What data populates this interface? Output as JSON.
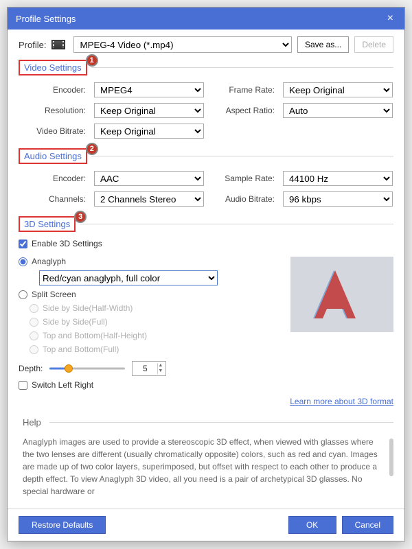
{
  "title": "Profile Settings",
  "profile": {
    "label": "Profile:",
    "value": "MPEG-4 Video (*.mp4)",
    "save_as": "Save as...",
    "delete": "Delete"
  },
  "sections": {
    "video": {
      "title": "Video Settings",
      "badge": "1"
    },
    "audio": {
      "title": "Audio Settings",
      "badge": "2"
    },
    "threeD": {
      "title": "3D Settings",
      "badge": "3"
    },
    "help": {
      "title": "Help"
    }
  },
  "video": {
    "encoder_label": "Encoder:",
    "encoder": "MPEG4",
    "resolution_label": "Resolution:",
    "resolution": "Keep Original",
    "bitrate_label": "Video Bitrate:",
    "bitrate": "Keep Original",
    "framerate_label": "Frame Rate:",
    "framerate": "Keep Original",
    "aspect_label": "Aspect Ratio:",
    "aspect": "Auto"
  },
  "audio": {
    "encoder_label": "Encoder:",
    "encoder": "AAC",
    "channels_label": "Channels:",
    "channels": "2 Channels Stereo",
    "samplerate_label": "Sample Rate:",
    "samplerate": "44100 Hz",
    "bitrate_label": "Audio Bitrate:",
    "bitrate": "96 kbps"
  },
  "threeD": {
    "enable": "Enable 3D Settings",
    "anaglyph": "Anaglyph",
    "anaglyph_mode": "Red/cyan anaglyph, full color",
    "split": "Split Screen",
    "split_modes": {
      "sbs_half": "Side by Side(Half-Width)",
      "sbs_full": "Side by Side(Full)",
      "tb_half": "Top and Bottom(Half-Height)",
      "tb_full": "Top and Bottom(Full)"
    },
    "depth_label": "Depth:",
    "depth_value": "5",
    "switch_lr": "Switch Left Right",
    "link": "Learn more about 3D format"
  },
  "help_text": "Anaglyph images are used to provide a stereoscopic 3D effect, when viewed with glasses where the two lenses are different (usually chromatically opposite) colors, such as red and cyan. Images are made up of two color layers, superimposed, but offset with respect to each other to produce a depth effect. To view Anaglyph 3D video, all you need is a pair of archetypical 3D glasses. No special hardware or",
  "footer": {
    "restore": "Restore Defaults",
    "ok": "OK",
    "cancel": "Cancel"
  }
}
